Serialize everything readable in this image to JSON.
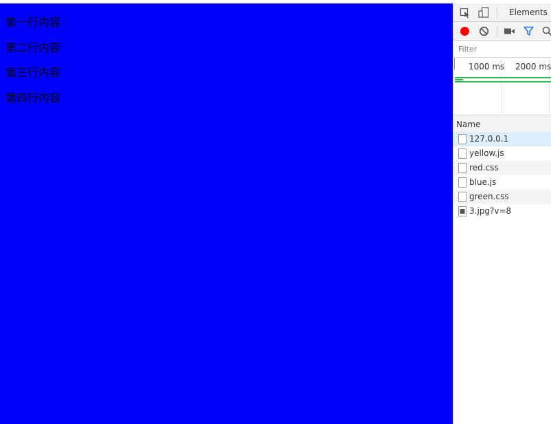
{
  "page": {
    "lines": [
      "第一行内容",
      "第二行内容",
      "第三行内容",
      "第四行内容"
    ],
    "background_color": "#0000ff"
  },
  "devtools": {
    "tabs": {
      "elements": "Elements"
    },
    "toolbar": {
      "icons": [
        "inspect-icon",
        "device-toggle-icon",
        "record-icon",
        "clear-icon",
        "screenshot-icon",
        "filter-icon",
        "search-icon"
      ],
      "record_color": "#ff0000",
      "filter_color": "#1a73e8"
    },
    "filter": {
      "placeholder": "Filter"
    },
    "overview": {
      "ticks": [
        "1000 ms",
        "2000 ms"
      ],
      "bar_color": "#2db84d"
    },
    "requests": {
      "header": "Name",
      "items": [
        {
          "name": "127.0.0.1",
          "type": "document"
        },
        {
          "name": "yellow.js",
          "type": "document"
        },
        {
          "name": "red.css",
          "type": "document"
        },
        {
          "name": "blue.js",
          "type": "document"
        },
        {
          "name": "green.css",
          "type": "document"
        },
        {
          "name": "3.jpg?v=8",
          "type": "image"
        }
      ]
    }
  }
}
